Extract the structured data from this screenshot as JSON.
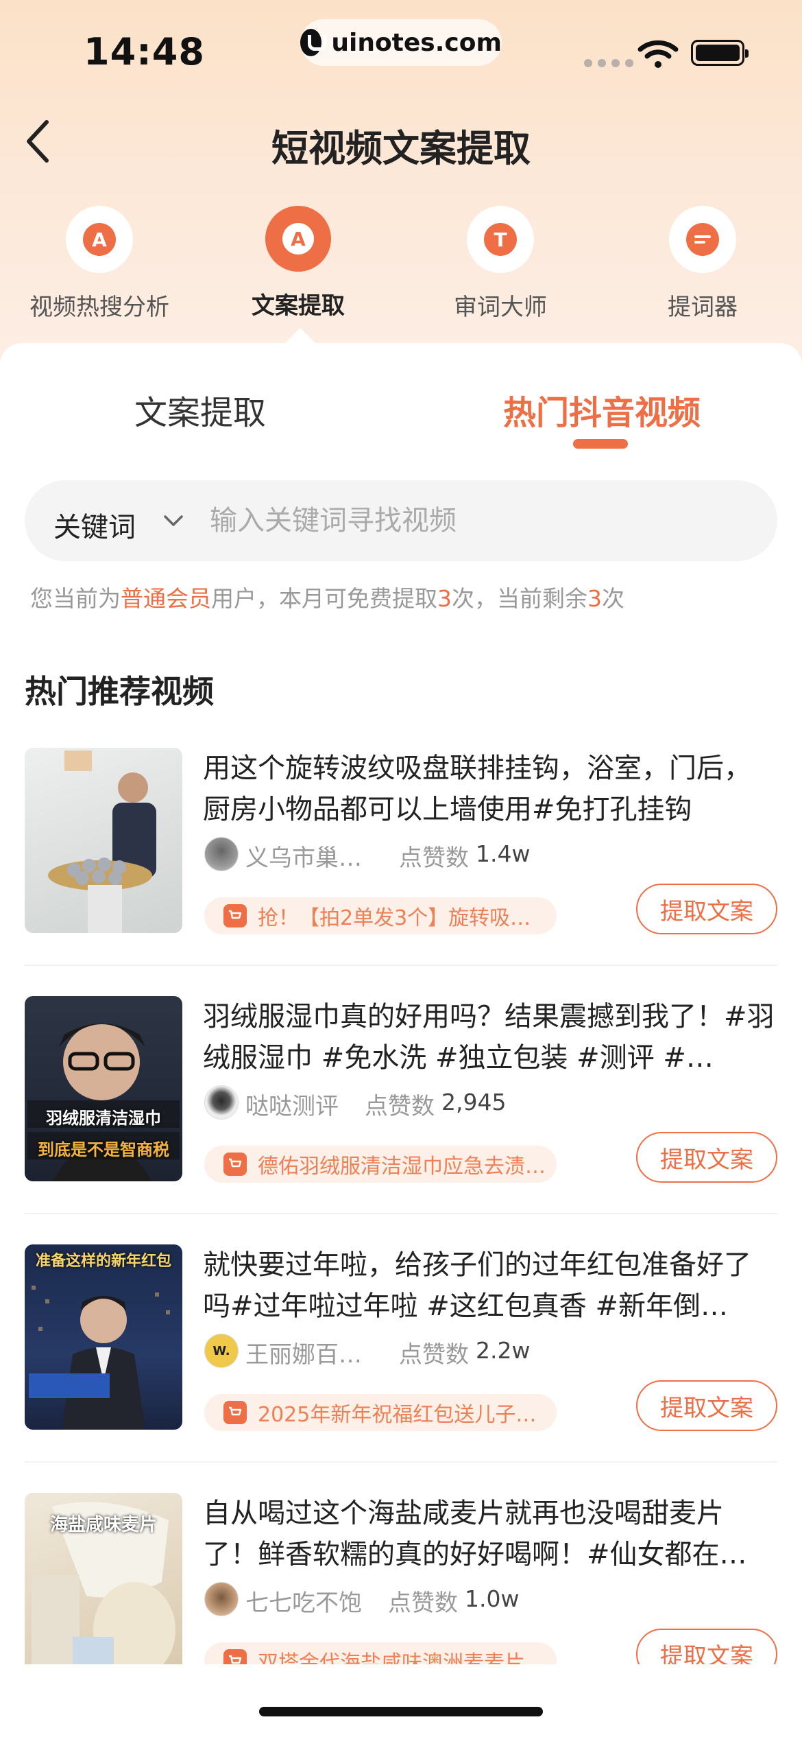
{
  "status_bar": {
    "time": "14:48",
    "url": "uinotes.com"
  },
  "header": {
    "title": "短视频文案提取"
  },
  "tools": [
    {
      "label": "视频热搜分析",
      "icon": "flame-icon",
      "glyph": "A"
    },
    {
      "label": "文案提取",
      "icon": "text-a-icon",
      "glyph": "A",
      "active": true
    },
    {
      "label": "审词大师",
      "icon": "text-t-icon",
      "glyph": "T"
    },
    {
      "label": "提词器",
      "icon": "prompter-icon",
      "glyph": ""
    }
  ],
  "subtabs": {
    "tab1": "文案提取",
    "tab2": "热门抖音视频"
  },
  "search": {
    "filter": "关键词",
    "placeholder": "输入关键词寻找视频",
    "value": ""
  },
  "quota": {
    "p1": "您当前为",
    "member": "普通会员",
    "p2": "用户，本月可免费提取",
    "free": "3",
    "p3": "次，当前剩余",
    "remaining": "3",
    "p4": "次"
  },
  "section_title": "热门推荐视频",
  "likes_label": "点赞数",
  "extract_label": "提取文案",
  "videos": [
    {
      "title": "用这个旋转波纹吸盘联排挂钩，浴室，门后，厨房小物品都可以上墙使用#免打孔挂钩",
      "author": "义乌市巢…",
      "likes": "1.4w",
      "product": "抢！【拍2单发3个】旋转吸…",
      "thumb_text": ""
    },
    {
      "title": "羽绒服湿巾真的好用吗？结果震撼到我了！#羽绒服湿巾 #免水洗 #独立包装 #测评 #…",
      "author": "哒哒测评",
      "likes": "2,945",
      "product": "德佑羽绒服清洁湿巾应急去渍…",
      "thumb_text": "羽绒服清洁湿巾",
      "thumb_text2": "到底是不是智商税"
    },
    {
      "title": "就快要过年啦，给孩子们的过年红包准备好了吗#过年啦过年啦 #这红包真香 #新年倒…",
      "author": "王丽娜百…",
      "likes": "2.2w",
      "product": "2025年新年祝福红包送儿子…",
      "thumb_text": "准备这样的新年红包",
      "avatar_text": "W."
    },
    {
      "title": "自从喝过这个海盐咸麦片就再也没喝甜麦片了！鲜香软糯的真的好好喝啊！#仙女都在…",
      "author": "七七吃不饱",
      "likes": "1.0w",
      "product": "双塔金代海盐咸味澳洲麦麦片",
      "thumb_text": "海盐咸味麦片"
    }
  ],
  "colors": {
    "accent": "#ee6f45",
    "accent_light": "#fdf0e8",
    "muted": "#999999"
  }
}
